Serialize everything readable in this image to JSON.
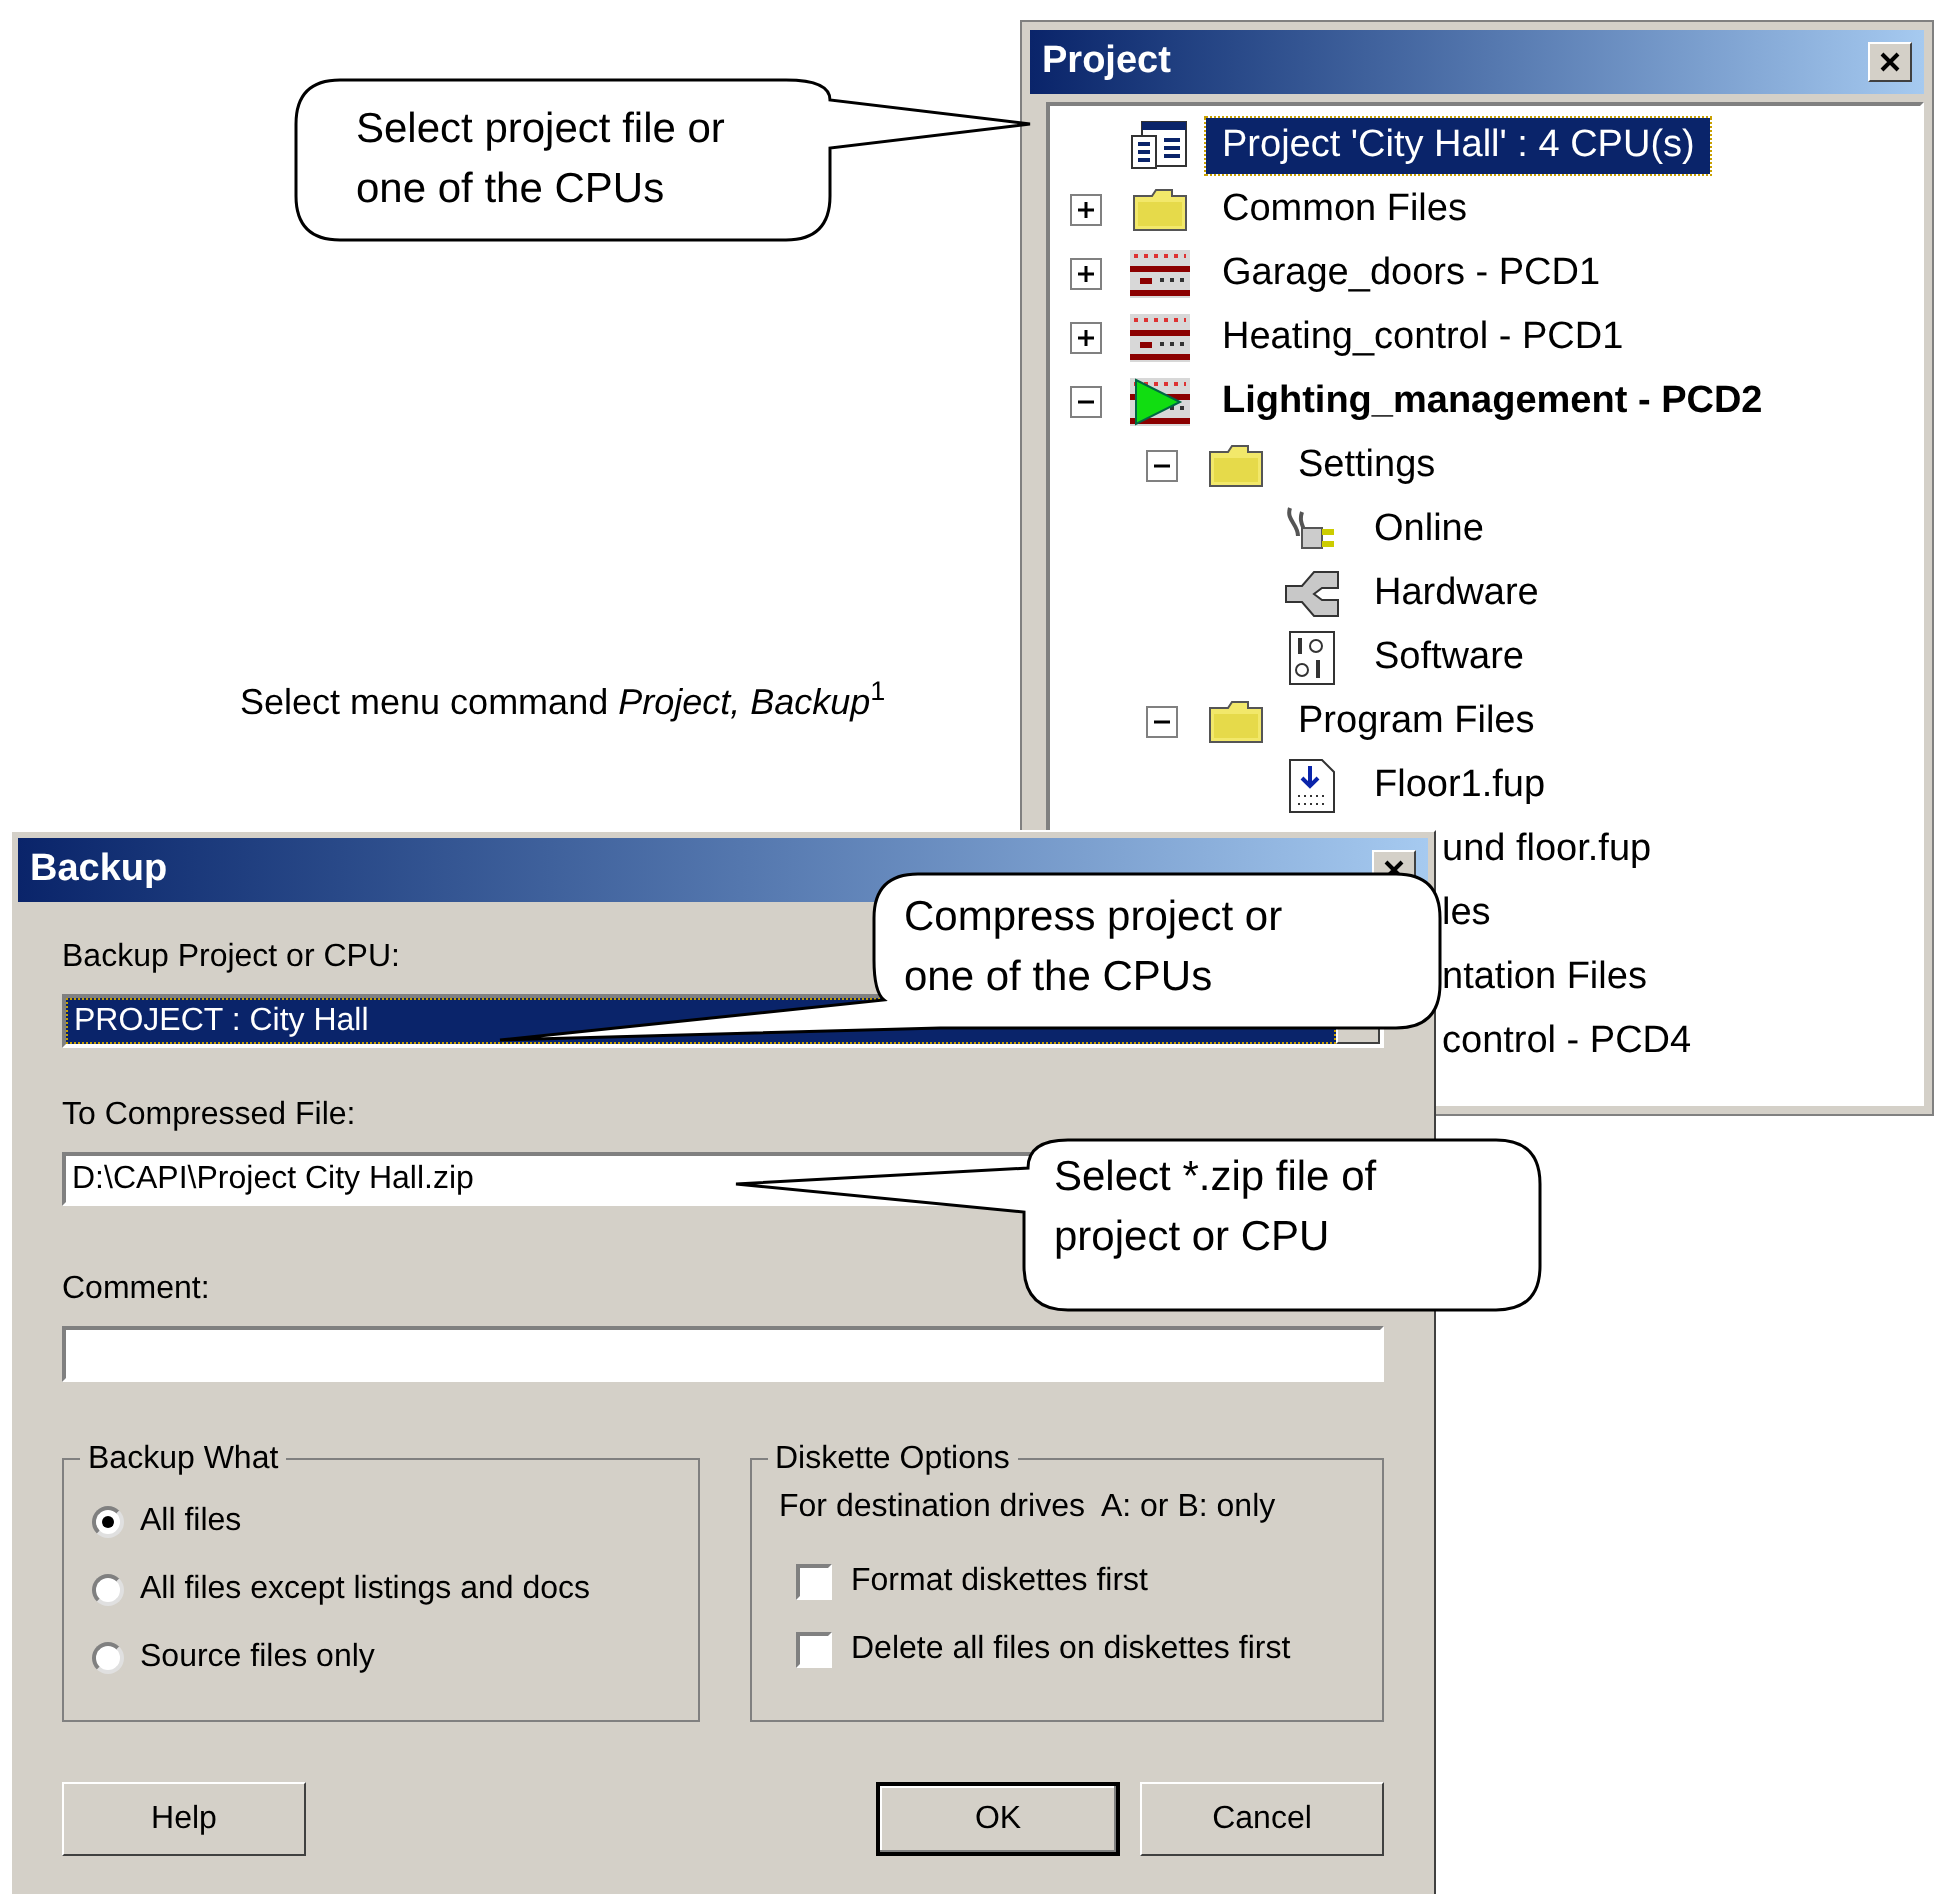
{
  "project_window": {
    "title": "Project",
    "tree": [
      {
        "label": "Project 'City Hall' : 4 CPU(s)",
        "kind": "project",
        "selected": true,
        "children": [
          {
            "label": "Common Files",
            "kind": "folder",
            "selected": false,
            "expanded": false
          },
          {
            "label": "Garage_doors - PCD1",
            "kind": "cpu",
            "selected": false,
            "expanded": false
          },
          {
            "label": "Heating_control - PCD1",
            "kind": "cpu",
            "selected": false,
            "expanded": false
          },
          {
            "label": "Lighting_management - PCD2",
            "kind": "cpu-active",
            "selected": false,
            "expanded": true,
            "children": [
              {
                "label": "Settings",
                "kind": "folder",
                "selected": false,
                "expanded": true,
                "children": [
                  {
                    "label": "Online",
                    "kind": "online",
                    "selected": false
                  },
                  {
                    "label": "Hardware",
                    "kind": "hardware",
                    "selected": false
                  },
                  {
                    "label": "Software",
                    "kind": "software",
                    "selected": false
                  }
                ]
              },
              {
                "label": "Program Files",
                "kind": "folder",
                "selected": false,
                "expanded": true,
                "children": [
                  {
                    "label": "Floor1.fup",
                    "kind": "file",
                    "selected": false
                  }
                ]
              }
            ]
          }
        ]
      }
    ],
    "partly_hidden_rows": [
      "und floor.fup",
      "les",
      "ntation Files",
      "control - PCD4"
    ]
  },
  "instruction": "Select menu command *Project, Backup*$^{1}$",
  "backup_dialog": {
    "title": "Backup",
    "project_label": "Backup Project or CPU:",
    "project_value": "PROJECT : City Hall",
    "file_label": "To Compressed File:",
    "file_value": "D:\\CAPI\\Project City Hall.zip",
    "comment_label": "Comment:",
    "backup_what": {
      "title": "Backup What",
      "options": [
        {
          "label": "All files",
          "selected": true
        },
        {
          "label": "All files except listings and docs",
          "selected": false
        },
        {
          "label": "Source files only",
          "selected": false
        }
      ]
    },
    "diskette_options": {
      "title": "Diskette Options",
      "note": "For destination drives  A: or B: only",
      "options": [
        {
          "label": "Format diskettes first",
          "checked": false
        },
        {
          "label": "Delete all files on diskettes first",
          "checked": false
        }
      ]
    },
    "buttons": [
      {
        "label": "Help",
        "default": false
      },
      {
        "label": "OK",
        "default": true
      },
      {
        "label": "Cancel",
        "default": false
      }
    ]
  },
  "callouts": [
    "Select project file or\none of the CPUs",
    "Compress project or\none of the CPUs",
    "Select *.zip file of\nproject or CPU"
  ]
}
